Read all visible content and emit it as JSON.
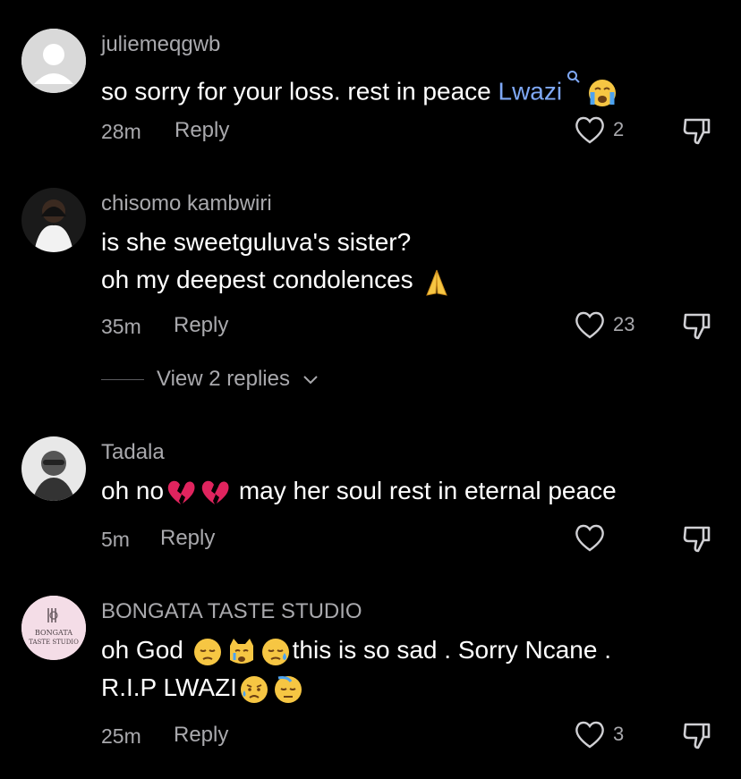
{
  "comments": [
    {
      "username": "juliemeqgwb",
      "text_before": "so sorry for your loss. rest in peace ",
      "mention": "Lwazi",
      "time": "28m",
      "reply_label": "Reply",
      "likes": "2"
    },
    {
      "username": "chisomo kambwiri",
      "line1": "is she sweetguluva's sister?",
      "line2": "oh my deepest condolences ",
      "time": "35m",
      "reply_label": "Reply",
      "likes": "23",
      "view_replies": "View 2 replies"
    },
    {
      "username": "Tadala",
      "text_before": "oh no",
      "text_after": " may her soul rest in eternal peace",
      "time": "5m",
      "reply_label": "Reply"
    },
    {
      "username": "BONGATA TASTE STUDIO",
      "avatar_text": "BONGATA TASTE STUDIO",
      "line1_a": "oh God ",
      "line1_b": "this is so sad . Sorry Ncane .",
      "line2": "R.I.P LWAZI",
      "time": "25m",
      "reply_label": "Reply",
      "likes": "3"
    }
  ],
  "colors": {
    "background": "#000000",
    "secondary_text": "#a9a9ad",
    "mention": "#7fa8f5"
  },
  "icons": [
    "search-icon",
    "heart-icon",
    "dislike-icon",
    "chevron-down-icon",
    "crying-face-emoji",
    "folded-hands-emoji",
    "broken-heart-emoji",
    "pensive-face-emoji",
    "crying-cat-emoji",
    "sad-sweat-face-emoji",
    "disappointed-relieved-emoji",
    "downcast-sweat-emoji"
  ]
}
